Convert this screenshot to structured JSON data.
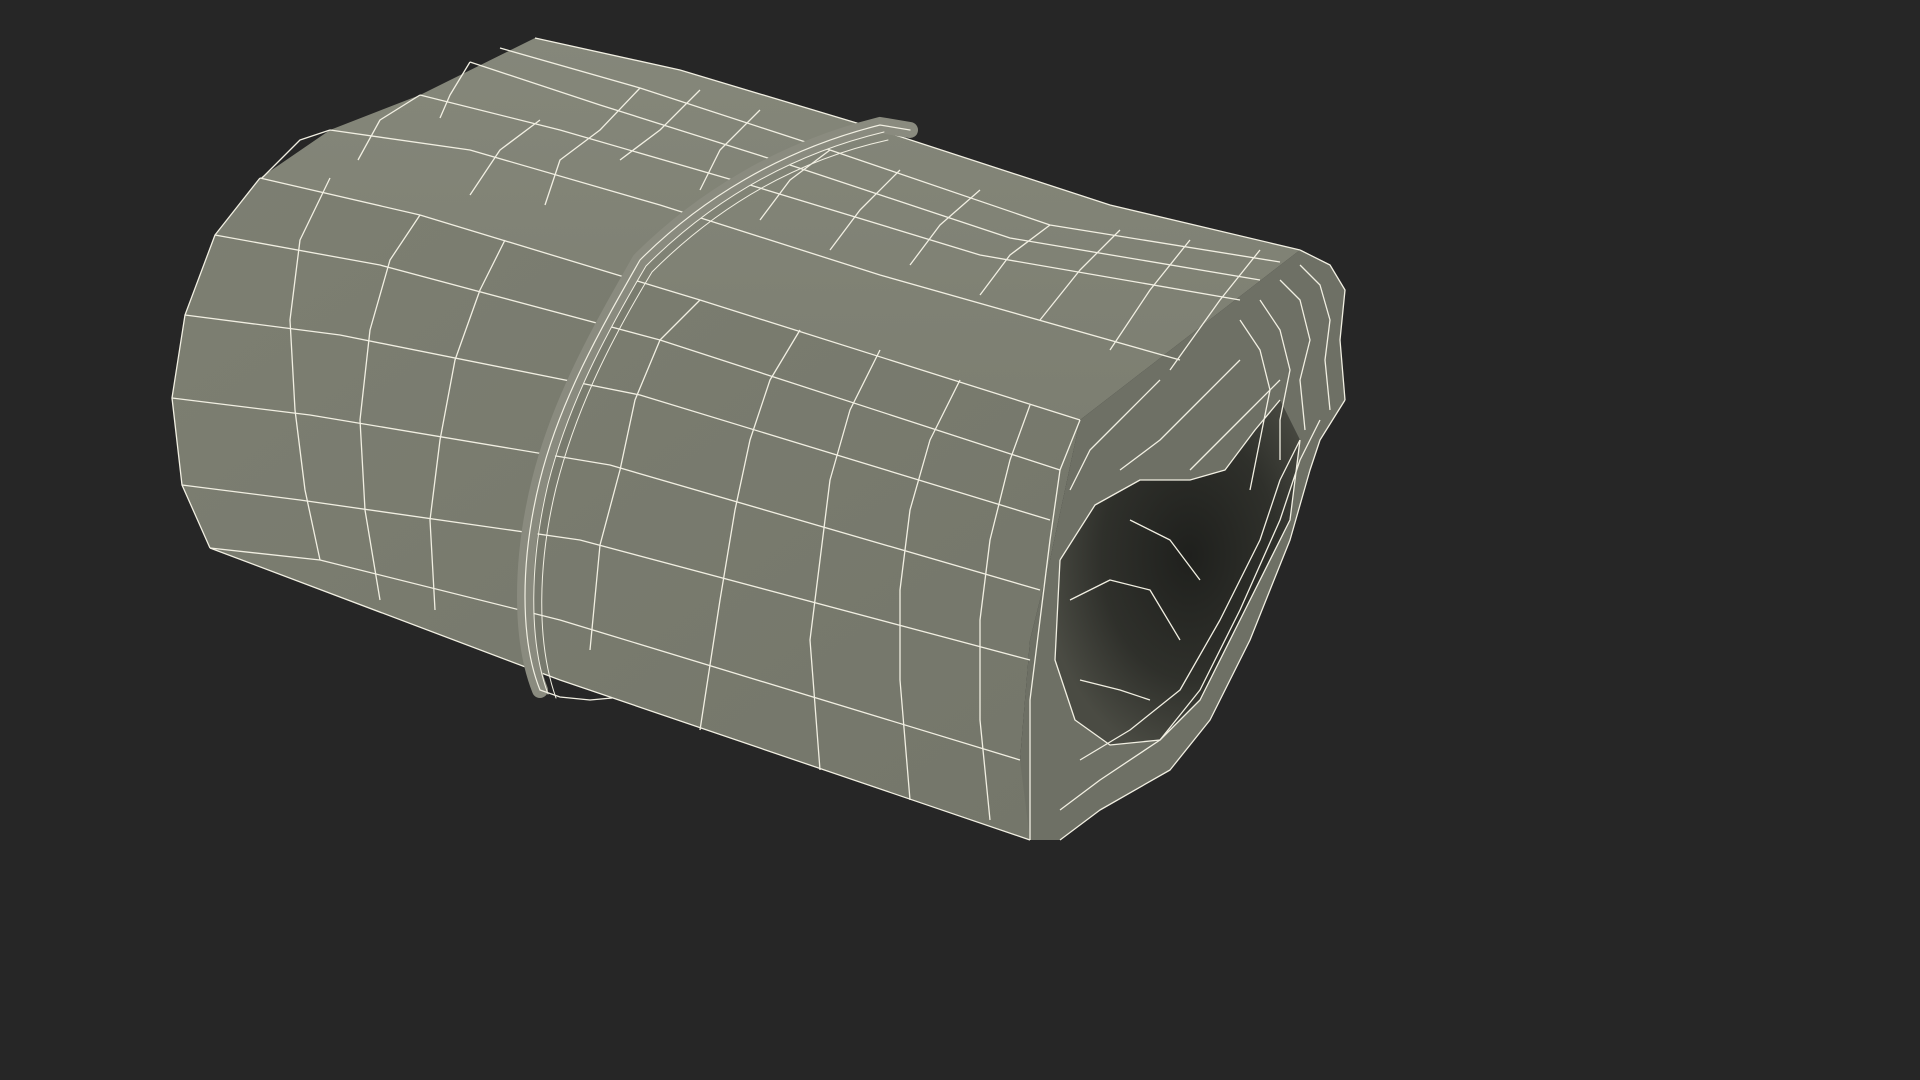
{
  "scene": {
    "subject": "rolled-newspaper-wireframe-render",
    "colors": {
      "background": "#262626",
      "surface": "#7a7b6e",
      "surface_shadow": "#5d5e54",
      "surface_light": "#85877a",
      "inner_dark": "#2b2c28",
      "wire": "#f1efe2",
      "band": "#8a8b7f"
    }
  }
}
